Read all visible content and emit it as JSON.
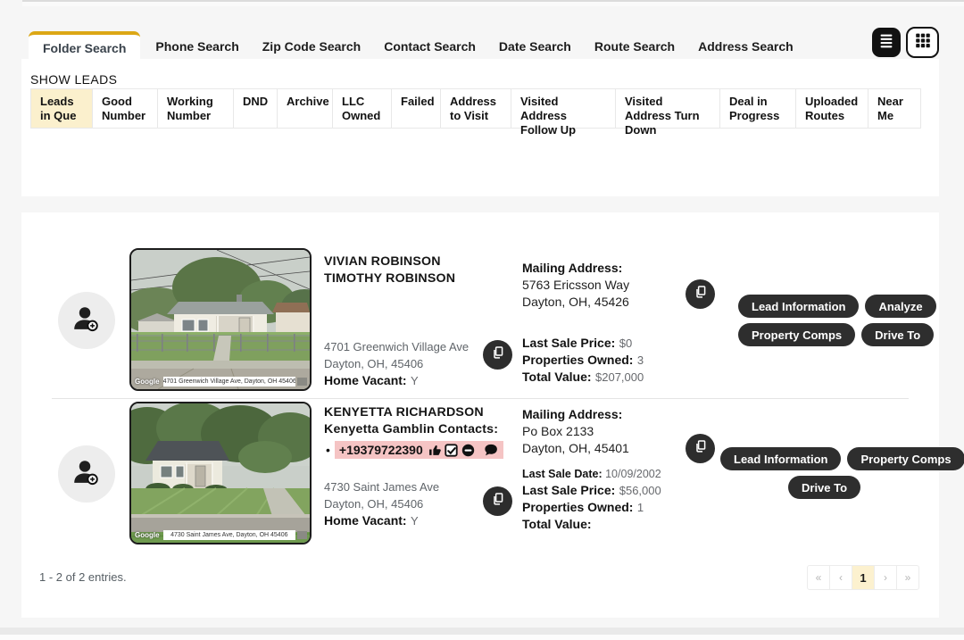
{
  "colors": {
    "accent_gold": "#dca715",
    "active_filter_bg": "#fbf0cd",
    "button_dark": "#2e2e2e",
    "contact_highlight": "#f5c4c4",
    "current_page_bg": "#fcf1cf"
  },
  "icons": [
    "list-view-icon",
    "grid-view-icon",
    "person-add-icon",
    "copy-icon",
    "thumbs-up-icon",
    "checkbox-checked-icon",
    "dnd-circle-icon",
    "comment-icon"
  ],
  "nav": {
    "tabs": [
      "Folder Search",
      "Phone Search",
      "Zip Code Search",
      "Contact Search",
      "Date Search",
      "Route Search",
      "Address Search"
    ],
    "active_tab": "Folder Search"
  },
  "show_leads": {
    "title": "SHOW LEADS",
    "active_filter": "Leads in Que",
    "filters": [
      "Leads in Que",
      "Good Number",
      "Working Number",
      "DND",
      "Archive",
      "LLC Owned",
      "Failed",
      "Address to Visit",
      "Visited Address Follow Up",
      "Visited Address Turn Down",
      "Deal in Progress",
      "Uploaded Routes",
      "Near Me"
    ]
  },
  "leads": [
    {
      "name_line1": "VIVIAN ROBINSON",
      "name_line2": "TIMOTHY ROBINSON",
      "photo_caption": "4701 Greenwich Village Ave, Dayton, OH 45406",
      "photo_watermark": "Google",
      "address_line1": "4701 Greenwich Village Ave",
      "address_line2": "Dayton, OH, 45406",
      "home_vacant_label": "Home Vacant:",
      "home_vacant_value": "Y",
      "mailing_label": "Mailing Address:",
      "mailing_line1": "5763 Ericsson Way",
      "mailing_line2": "Dayton, OH, 45426",
      "last_sale_price_label": "Last Sale Price:",
      "last_sale_price": "$0",
      "properties_owned_label": "Properties Owned:",
      "properties_owned": "3",
      "total_value_label": "Total Value:",
      "total_value": "$207,000",
      "buttons": [
        "Lead Information",
        "Analyze",
        "Property Comps",
        "Drive To"
      ]
    },
    {
      "name_line1": "KENYETTA RICHARDSON",
      "contacts_label": "Kenyetta Gamblin Contacts:",
      "contact_bullet": "•",
      "contact_phone": "+19379722390",
      "photo_caption": "4730 Saint James Ave, Dayton, OH 45406",
      "photo_watermark": "Google",
      "address_line1": "4730 Saint James Ave",
      "address_line2": "Dayton, OH, 45406",
      "home_vacant_label": "Home Vacant:",
      "home_vacant_value": "Y",
      "mailing_label": "Mailing Address:",
      "mailing_line1": "Po Box 2133",
      "mailing_line2": "Dayton, OH, 45401",
      "last_sale_date_label": "Last Sale Date:",
      "last_sale_date": "10/09/2002",
      "last_sale_price_label": "Last Sale Price:",
      "last_sale_price": "$56,000",
      "properties_owned_label": "Properties Owned:",
      "properties_owned": "1",
      "total_value_label": "Total Value:",
      "total_value": "",
      "buttons": [
        "Lead Information",
        "Property Comps",
        "Drive To"
      ]
    }
  ],
  "pagination": {
    "summary": "1 - 2 of 2 entries.",
    "first_label": "«",
    "prev_label": "‹",
    "current_page": "1",
    "next_label": "›",
    "last_label": "»"
  }
}
